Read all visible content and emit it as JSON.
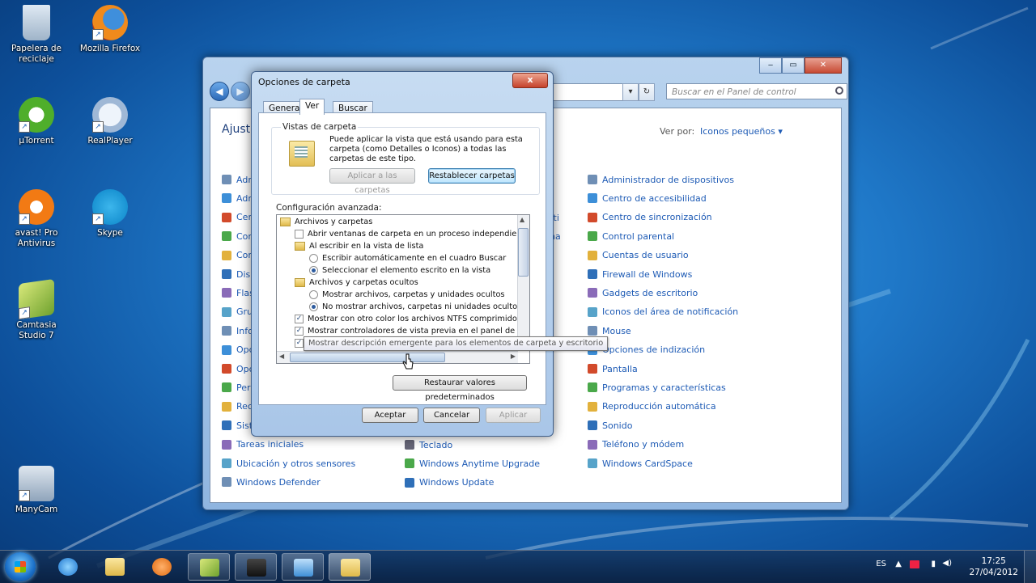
{
  "desktop": {
    "icons": [
      {
        "label": "Papelera de reciclaje",
        "icon": "recycle-bin-icon"
      },
      {
        "label": "Mozilla Firefox",
        "icon": "firefox-icon"
      },
      {
        "label": "µTorrent",
        "icon": "utorrent-icon"
      },
      {
        "label": "RealPlayer",
        "icon": "realplayer-icon"
      },
      {
        "label": "avast! Pro Antivirus",
        "icon": "avast-icon"
      },
      {
        "label": "Skype",
        "icon": "skype-icon"
      },
      {
        "label": "Camtasia Studio 7",
        "icon": "camtasia-icon"
      },
      {
        "label": "ManyCam",
        "icon": "manycam-icon"
      }
    ]
  },
  "control_panel": {
    "search_placeholder": "Buscar en el Panel de control",
    "heading": "Ajusta",
    "view_by_label": "Ver por:",
    "view_by_value": "Iconos pequeños ▾",
    "left_items": [
      "Adm",
      "Adm",
      "Cen",
      "Con",
      "Con",
      "Disp",
      "Flas",
      "Gru",
      "Info",
      "Opc",
      "Opc",
      "Pers",
      "Rec",
      "Siste",
      "Tareas iniciales",
      "Ubicación y otros sensores",
      "Windows Defender"
    ],
    "middle_fragments": [
      "rti",
      "na"
    ],
    "middle_items": [
      "Teclado",
      "Windows Anytime Upgrade",
      "Windows Update"
    ],
    "right_items": [
      "Administrador de dispositivos",
      "Centro de accesibilidad",
      "Centro de sincronización",
      "Control parental",
      "Cuentas de usuario",
      "Firewall de Windows",
      "Gadgets de escritorio",
      "Iconos del área de notificación",
      "Mouse",
      "Opciones de indización",
      "Pantalla",
      "Programas y características",
      "Reproducción automática",
      "Sonido",
      "Teléfono y módem",
      "Windows CardSpace"
    ]
  },
  "dialog": {
    "title": "Opciones de carpeta",
    "close_label": "x",
    "tabs": [
      "General",
      "Ver",
      "Buscar"
    ],
    "active_tab": "Ver",
    "folder_views_label": "Vistas de carpeta",
    "folder_views_desc": "Puede aplicar la vista que está usando para esta carpeta (como Detalles o Iconos) a todas las carpetas de este tipo.",
    "apply_folders_label": "Aplicar a las carpetas",
    "reset_folders_label": "Restablecer carpetas",
    "advanced_label": "Configuración avanzada:",
    "tree": [
      {
        "type": "folder",
        "label": "Archivos y carpetas",
        "indent": 0
      },
      {
        "type": "checkbox",
        "checked": false,
        "label": "Abrir ventanas de carpeta  en un proceso independiente",
        "indent": 1
      },
      {
        "type": "folder",
        "label": "Al escribir en la vista de lista",
        "indent": 1
      },
      {
        "type": "radio",
        "checked": false,
        "label": "Escribir automáticamente en el cuadro Buscar",
        "indent": 2
      },
      {
        "type": "radio",
        "checked": true,
        "label": "Seleccionar el elemento escrito en la vista",
        "indent": 2
      },
      {
        "type": "folder",
        "label": "Archivos y carpetas ocultos",
        "indent": 1
      },
      {
        "type": "radio",
        "checked": false,
        "label": "Mostrar archivos, carpetas y unidades ocultos",
        "indent": 2
      },
      {
        "type": "radio",
        "checked": true,
        "label": "No mostrar archivos, carpetas ni unidades ocultos",
        "indent": 2
      },
      {
        "type": "checkbox",
        "checked": true,
        "label": "Mostrar con otro color los archivos NTFS comprimidos o c",
        "indent": 1
      },
      {
        "type": "checkbox",
        "checked": true,
        "label": "Mostrar controladores de vista previa en el panel de vista",
        "indent": 1
      },
      {
        "type": "checkbox",
        "checked": true,
        "label": "Mostrar descripción emergente para los elementos de carpeta y escritorio",
        "indent": 1
      }
    ],
    "tooltip": "Mostrar descripción emergente para los elementos de carpeta y escritorio",
    "restore_defaults_label": "Restaurar valores predeterminados",
    "ok_label": "Aceptar",
    "cancel_label": "Cancelar",
    "apply_label": "Aplicar"
  },
  "taskbar": {
    "pinned": [
      "ie-icon",
      "explorer-icon",
      "media-player-icon",
      "camtasia-icon",
      "recorder-icon",
      "control-panel-icon",
      "folder-options-icon"
    ],
    "language": "ES",
    "time": "17:25",
    "date": "27/04/2012"
  },
  "colors": {
    "link": "#1e5bb5",
    "desktop": "#1f78c8"
  }
}
